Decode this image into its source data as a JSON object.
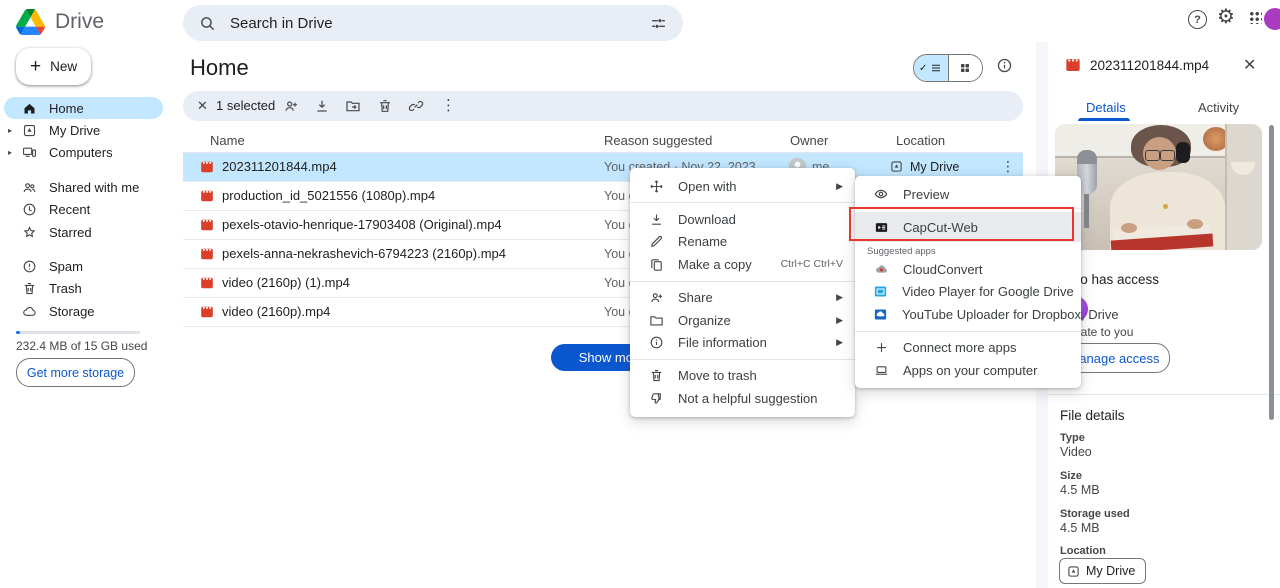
{
  "topbar": {
    "app_name": "Drive",
    "search_placeholder": "Search in Drive"
  },
  "sidebar": {
    "new_button": "New",
    "items": [
      {
        "label": "Home"
      },
      {
        "label": "My Drive"
      },
      {
        "label": "Computers"
      },
      {
        "label": "Shared with me"
      },
      {
        "label": "Recent"
      },
      {
        "label": "Starred"
      },
      {
        "label": "Spam"
      },
      {
        "label": "Trash"
      },
      {
        "label": "Storage"
      }
    ],
    "storage_summary": "232.4 MB of 15 GB used",
    "get_more_storage": "Get more storage"
  },
  "main": {
    "title": "Home",
    "selection_toolbar": {
      "selected_label": "1 selected"
    },
    "table": {
      "headers": {
        "name": "Name",
        "reason": "Reason suggested",
        "owner": "Owner",
        "location": "Location"
      },
      "rows": [
        {
          "name": "202311201844.mp4",
          "reason": "You created · Nov 22, 2023",
          "owner": "me",
          "location": "My Drive"
        },
        {
          "name": "production_id_5021556 (1080p).mp4",
          "reason": "You c"
        },
        {
          "name": "pexels-otavio-henrique-17903408 (Original).mp4",
          "reason": "You o"
        },
        {
          "name": "pexels-anna-nekrashevich-6794223 (2160p).mp4",
          "reason": "You c"
        },
        {
          "name": "video (2160p) (1).mp4",
          "reason": "You c"
        },
        {
          "name": "video (2160p).mp4",
          "reason": "You c"
        }
      ]
    },
    "show_more_button": "Show more files"
  },
  "context_menu": {
    "open_with": "Open with",
    "download": "Download",
    "rename": "Rename",
    "make_a_copy": "Make a copy",
    "make_a_copy_shortcut": "Ctrl+C Ctrl+V",
    "share": "Share",
    "organize": "Organize",
    "file_information": "File information",
    "move_to_trash": "Move to trash",
    "not_helpful": "Not a helpful suggestion"
  },
  "open_with_menu": {
    "preview": "Preview",
    "capcut": "CapCut-Web",
    "suggested_apps_label": "Suggested apps",
    "cloudconvert": "CloudConvert",
    "video_player": "Video Player for Google Drive",
    "youtube_uploader": "YouTube Uploader for Dropbox, Drive",
    "connect_more": "Connect more apps",
    "apps_on_computer": "Apps on your computer"
  },
  "details_panel": {
    "title": "202311201844.mp4",
    "tabs": {
      "details": "Details",
      "activity": "Activity"
    },
    "access": {
      "heading": "Who has access",
      "privacy": "Private to you",
      "manage_button": "Manage access"
    },
    "file_details": {
      "heading": "File details",
      "type_label": "Type",
      "type_value": "Video",
      "size_label": "Size",
      "size_value": "4.5 MB",
      "storage_label": "Storage used",
      "storage_value": "4.5 MB",
      "location_label": "Location",
      "location_value": "My Drive"
    }
  },
  "icons": {
    "gear": "⚙",
    "more_vertical": "⋮",
    "chevron_right": "▶",
    "caret_right": "▸",
    "check": "✓",
    "close": "✕",
    "plus": "+",
    "help": "?"
  },
  "colors": {
    "accent_blue": "#0b57d0",
    "selection_blue": "#c2e7ff",
    "annotation_red": "#e8382c",
    "file_icon_red": "#d93f2b"
  }
}
